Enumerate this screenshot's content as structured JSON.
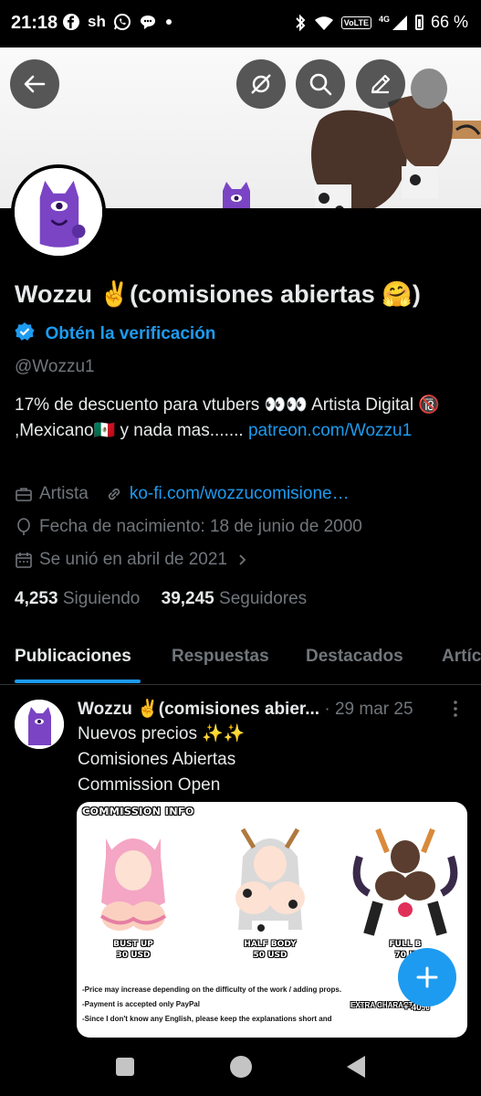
{
  "status_bar": {
    "time": "21:18",
    "left_icons": [
      "facebook-icon",
      "sh-icon",
      "whatsapp-icon",
      "chat-icon",
      "dot-icon"
    ],
    "sh_label": "sh",
    "volte_label": "VoLTE",
    "network": "4G",
    "battery_pct": "66 %"
  },
  "header": {
    "buttons": [
      "back-arrow-icon",
      "no-sync-icon",
      "search-icon",
      "edit-icon"
    ]
  },
  "profile": {
    "name": "Wozzu ✌️(comisiones abiertas 🤗)",
    "verify_cta": "Obtén la verificación",
    "handle": "@Wozzu1",
    "bio_text": "17% de descuento para vtubers 👀👀 Artista Digital 🔞 ,Mexicano🇲🇽 y nada mas....... ",
    "bio_link": "patreon.com/Wozzu1",
    "category": "Artista",
    "website": "ko-fi.com/wozzucomisione…",
    "birthday": "Fecha de nacimiento: 18 de junio de 2000",
    "joined": "Se unió en abril de 2021",
    "following_count": "4,253",
    "following_label": "Siguiendo",
    "followers_count": "39,245",
    "followers_label": "Seguidores"
  },
  "tabs": [
    "Publicaciones",
    "Respuestas",
    "Destacados",
    "Artíc"
  ],
  "post": {
    "author": "Wozzu ✌️(comisiones abier...",
    "date": "· 29 mar 25",
    "lines": [
      "Nuevos precios ✨✨",
      "Comisiones Abiertas",
      "Commission  Open"
    ],
    "media": {
      "title": "COMMISSION INFO",
      "prices": [
        {
          "label": "BUST UP",
          "price": "30 USD"
        },
        {
          "label": "HALF BODY",
          "price": "50 USD"
        },
        {
          "label": "FULL B",
          "price": "70 U"
        }
      ],
      "notes": [
        "-Price may increase depending on the difficulty of the work / adding props.",
        "-Payment is accepted only PayPal",
        "-Since I don't know any English, please keep the explanations short and"
      ],
      "extra": "EXTRA CHARACTER",
      "extra_pct": "+ 40%"
    }
  },
  "colors": {
    "accent": "#1d9bf0",
    "background": "#000000",
    "text_primary": "#e7e9ea",
    "text_secondary": "#71767b",
    "mascot": "#7b44c4"
  }
}
